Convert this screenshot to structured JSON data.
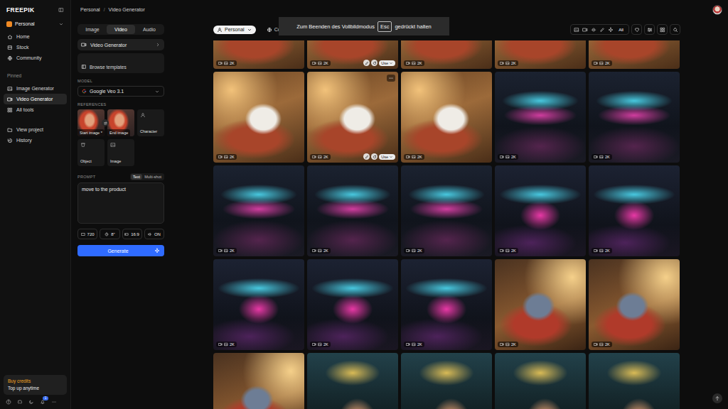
{
  "sidebar": {
    "logo": "FREEPIK",
    "workspace": "Personal",
    "nav": [
      {
        "label": "Home",
        "kind": "home",
        "selected": false
      },
      {
        "label": "Stock",
        "kind": "stock",
        "selected": false
      },
      {
        "label": "Community",
        "kind": "community",
        "selected": false
      }
    ],
    "pinned_label": "Pinned",
    "pinned": [
      {
        "label": "Image Generator",
        "kind": "image",
        "selected": false
      },
      {
        "label": "Video Generator",
        "kind": "video",
        "selected": true
      },
      {
        "label": "All tools",
        "kind": "tools",
        "selected": false
      }
    ],
    "more": [
      {
        "label": "View project",
        "kind": "project",
        "selected": false
      },
      {
        "label": "History",
        "kind": "history",
        "selected": false
      }
    ],
    "credits": {
      "title": "Buy credits",
      "subtitle": "Top up anytime"
    },
    "notifications": "1"
  },
  "breadcrumb": {
    "items": [
      "Personal",
      "Video Generator"
    ],
    "separator": "/"
  },
  "panel": {
    "tabs": [
      {
        "label": "Image",
        "selected": false
      },
      {
        "label": "Video",
        "selected": true
      },
      {
        "label": "Audio",
        "selected": false
      }
    ],
    "tool": "Video Generator",
    "templates": "Browse templates",
    "model_label": "MODEL",
    "model": "Google Veo 3.1",
    "references_label": "REFERENCES",
    "references": [
      {
        "label": "Start image *",
        "kind": "image",
        "filled": true
      },
      {
        "label": "End image",
        "kind": "image",
        "filled": true
      },
      {
        "label": "Character",
        "kind": "person",
        "filled": false
      },
      {
        "label": "Object",
        "kind": "object",
        "filled": false
      },
      {
        "label": "Image",
        "kind": "image",
        "filled": false
      }
    ],
    "prompt_label": "PROMPT",
    "prompt_modes": [
      {
        "label": "Text",
        "selected": true
      },
      {
        "label": "Multi-shot",
        "selected": false
      }
    ],
    "prompt": "move to the product",
    "options": [
      {
        "label": "720",
        "kind": "resolution"
      },
      {
        "label": "8\"",
        "kind": "duration"
      },
      {
        "label": "16:9",
        "kind": "ratio"
      },
      {
        "label": "ON",
        "kind": "audio"
      }
    ],
    "generate": "Generate"
  },
  "filters": {
    "scope": [
      {
        "label": "Personal",
        "selected": true
      },
      {
        "label": "Commu",
        "selected": false
      }
    ],
    "media": [
      {
        "kind": "image",
        "selected": false
      },
      {
        "kind": "video",
        "selected": false
      },
      {
        "kind": "wave",
        "selected": false
      },
      {
        "kind": "pencil",
        "selected": false
      },
      {
        "kind": "sparkle",
        "selected": false
      }
    ],
    "all": {
      "label": "All",
      "selected": true
    }
  },
  "toast": {
    "before": "Zum Beenden des Vollbildmodus",
    "key": "Esc",
    "after": "gedrückt halten"
  },
  "gallery": {
    "use_label": "Use",
    "tiles": [
      {
        "kind": "cat-room",
        "badge": "2K",
        "hovered": false
      },
      {
        "kind": "cat-room",
        "badge": "2K",
        "hovered": true
      },
      {
        "kind": "cat-room",
        "badge": "2K",
        "hovered": false
      },
      {
        "kind": "cat-room",
        "badge": "2K",
        "hovered": false
      },
      {
        "kind": "cat-room",
        "badge": "2K",
        "hovered": false
      },
      {
        "kind": "cat-room",
        "badge": "2K",
        "hovered": false
      },
      {
        "kind": "cat-room",
        "badge": "2K",
        "hovered": true
      },
      {
        "kind": "cat-room",
        "badge": "2K",
        "hovered": false
      },
      {
        "kind": "neon-training",
        "badge": "2K",
        "hovered": false
      },
      {
        "kind": "neon-training",
        "badge": "2K",
        "hovered": false
      },
      {
        "kind": "neon-training",
        "badge": "2K",
        "hovered": false
      },
      {
        "kind": "neon-training",
        "badge": "2K",
        "hovered": false
      },
      {
        "kind": "neon-training",
        "badge": "2K",
        "hovered": false
      },
      {
        "kind": "neon-ki",
        "badge": "2K",
        "hovered": false
      },
      {
        "kind": "neon-ki",
        "badge": "2K",
        "hovered": false
      },
      {
        "kind": "neon-ki",
        "badge": "2K",
        "hovered": false
      },
      {
        "kind": "neon-ki",
        "badge": "2K",
        "hovered": false
      },
      {
        "kind": "neon-ki",
        "badge": "2K",
        "hovered": false
      },
      {
        "kind": "cat-blue",
        "badge": "2K",
        "hovered": false
      },
      {
        "kind": "cat-blue",
        "badge": "2K",
        "hovered": false
      },
      {
        "kind": "cat-blue",
        "badge": "2K",
        "hovered": false
      },
      {
        "kind": "man-neon",
        "badge": "2K",
        "hovered": false
      },
      {
        "kind": "man-neon",
        "badge": "2K",
        "hovered": false
      },
      {
        "kind": "man-neon",
        "badge": "2K",
        "hovered": false
      },
      {
        "kind": "man-neon",
        "badge": "2K",
        "hovered": false
      }
    ]
  }
}
